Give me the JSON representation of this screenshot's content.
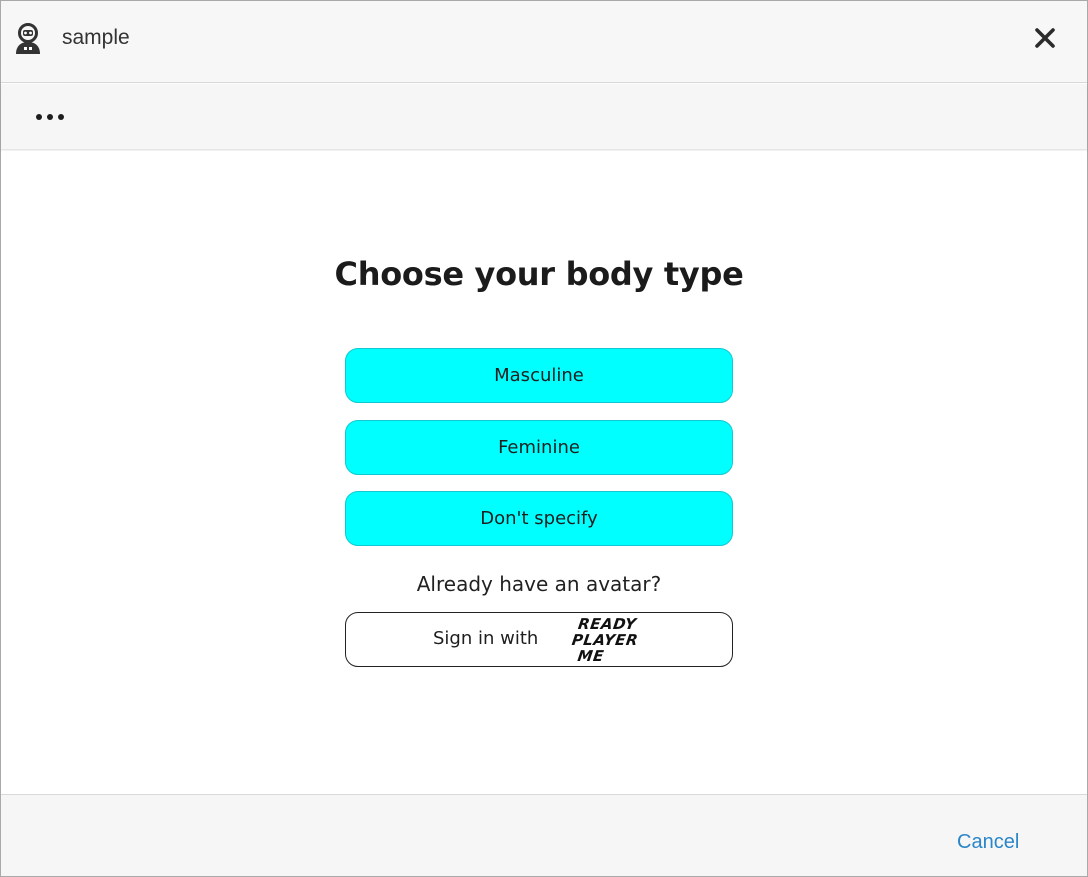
{
  "window": {
    "title": "sample",
    "app_icon": "avatar-robot-icon",
    "close_icon": "close-icon"
  },
  "menubar": {
    "more_icon": "more-horizontal-icon"
  },
  "main": {
    "heading": "Choose your body type",
    "options": [
      {
        "label": "Masculine"
      },
      {
        "label": "Feminine"
      },
      {
        "label": "Don't specify"
      }
    ],
    "already_text": "Already have an avatar?",
    "signin": {
      "label": "Sign in with",
      "logo_lines": [
        "READY",
        "PLAYER",
        "ME"
      ]
    }
  },
  "footer": {
    "cancel_label": "Cancel"
  },
  "colors": {
    "accent": "#00ffff",
    "accent_border": "#10c9d2",
    "link": "#2a86c8",
    "bar_background": "#f6f6f6"
  }
}
